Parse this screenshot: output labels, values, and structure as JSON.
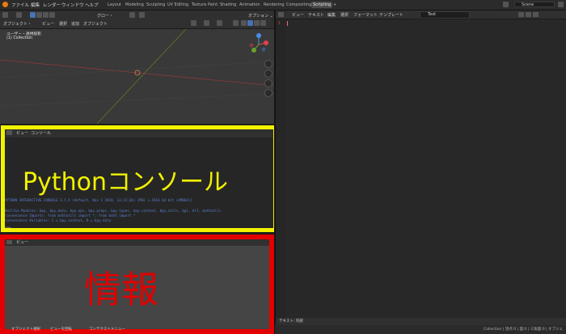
{
  "menu": {
    "items": [
      "ファイル",
      "編集",
      "レンダー",
      "ウィンドウ",
      "ヘルプ"
    ]
  },
  "workspaces": [
    "Layout",
    "Modeling",
    "Sculpting",
    "UV Editing",
    "Texture Paint",
    "Shading",
    "Animation",
    "Rendering",
    "Compositing",
    "Scripting"
  ],
  "active_workspace": "Scripting",
  "add_workspace": "+",
  "scene": "Scene",
  "viewport": {
    "header_row1": [
      "グロー・",
      "オプション ⌄"
    ],
    "header_row2": [
      "オブジェクト・",
      "ビュー",
      "選択",
      "追加",
      "オブジェクト"
    ],
    "view_label": "ユーザー・透視投影",
    "collection_label": "(1) Collection"
  },
  "console": {
    "header": [
      "ビュー",
      "コンソール"
    ],
    "overlay_label": "Pythonコンソール",
    "lines": [
      "PYTHON INTERACTIVE CONSOLE 3.7.4 (default, Nov  1 2019, 13:23:36) [MSC v.1916 64 bit (AMD64)]",
      "Builtin Modules:      bpy, bpy.data, bpy.ops, bpy.props, bpy.types, bpy.context, bpy.utils, bgl, blf, mathutils",
      "Convenience Imports:   from mathutils import *; from math import *",
      "Convenience Variables: C = bpy.context, D = bpy.data"
    ],
    "prompt": ">>>"
  },
  "info": {
    "header": [
      "ビュー"
    ],
    "overlay_label": "情報",
    "footer_items": [
      "オブジェクト選択",
      "ビューを回転",
      "コンテクストメニュー"
    ]
  },
  "text_editor": {
    "header": [
      "ビュー",
      "テキスト",
      "編集",
      "選択",
      "フォーマット",
      "テンプレート"
    ],
    "text_name": "Text",
    "line_number": "1",
    "footer": "テキスト: 内部"
  },
  "status_bar": "Collection | 頂点:0 | 面:0 | 三角面:0 | オブジェ",
  "colors": {
    "console_frame": "#f2f200",
    "info_frame": "#e30000",
    "accent": "#4772b3",
    "console_text": "#5b7fd1"
  }
}
